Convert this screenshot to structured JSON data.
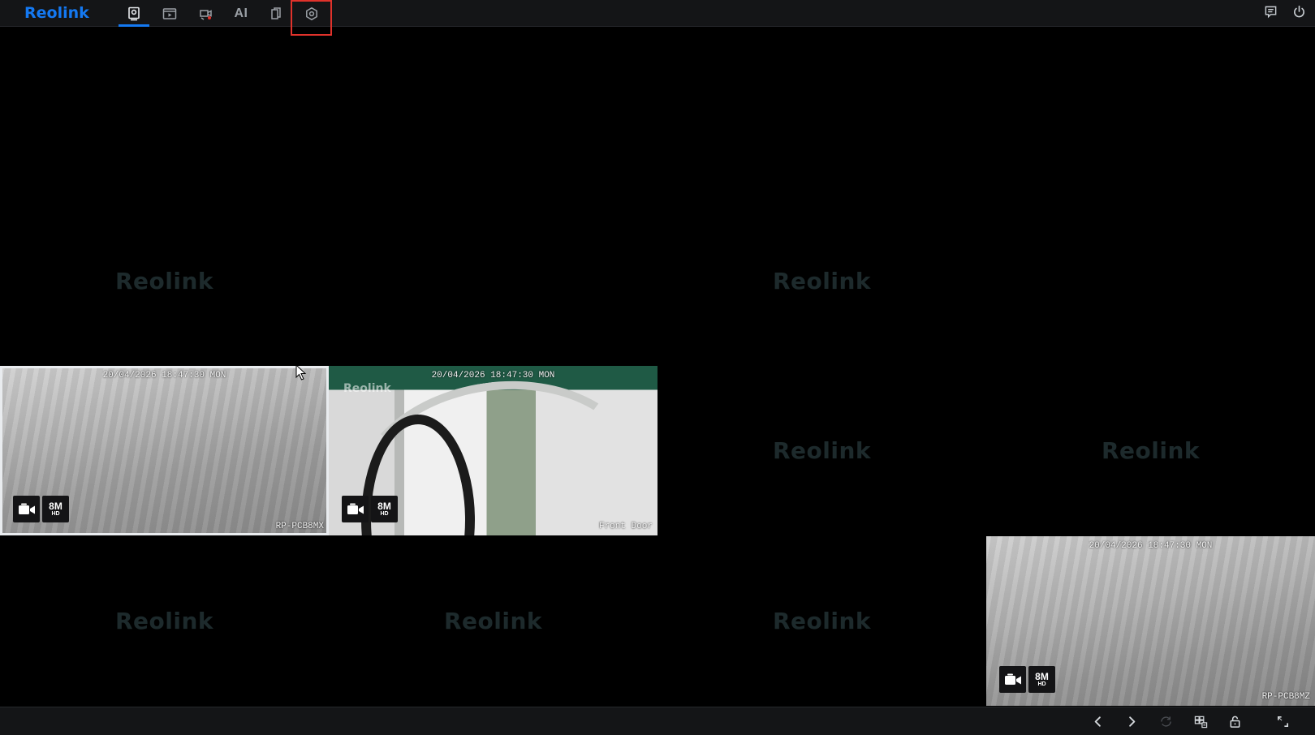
{
  "app": {
    "brand": "Reolink"
  },
  "nav": {
    "items": [
      {
        "id": "live-view",
        "icon": "live-view-icon"
      },
      {
        "id": "playback",
        "icon": "playback-icon"
      },
      {
        "id": "alarm-events",
        "icon": "alarm-events-icon"
      },
      {
        "id": "ai",
        "icon": "ai-icon",
        "label": "AI"
      },
      {
        "id": "files",
        "icon": "files-icon"
      },
      {
        "id": "settings",
        "icon": "settings-icon"
      }
    ],
    "active": "live-view",
    "highlighted": "settings"
  },
  "top_right": [
    {
      "id": "message",
      "icon": "message-icon"
    },
    {
      "id": "power",
      "icon": "power-icon"
    }
  ],
  "grid": {
    "watermark": "Reolink",
    "channels": [
      {
        "row": 1,
        "col": 1,
        "state": "empty"
      },
      {
        "row": 1,
        "col": 2,
        "state": "empty"
      },
      {
        "row": 1,
        "col": 3,
        "state": "empty"
      },
      {
        "row": 1,
        "col": 4,
        "state": "empty"
      },
      {
        "row": 2,
        "col": 1,
        "state": "empty"
      },
      {
        "row": 2,
        "col": 2,
        "state": "empty"
      },
      {
        "row": 2,
        "col": 3,
        "state": "empty"
      },
      {
        "row": 2,
        "col": 4,
        "state": "empty"
      },
      {
        "row": 3,
        "col": 1,
        "state": "live"
      },
      {
        "row": 3,
        "col": 2,
        "state": "live"
      },
      {
        "row": 3,
        "col": 3,
        "state": "empty"
      },
      {
        "row": 3,
        "col": 4,
        "state": "empty"
      },
      {
        "row": 4,
        "col": 1,
        "state": "empty"
      },
      {
        "row": 4,
        "col": 2,
        "state": "empty"
      },
      {
        "row": 4,
        "col": 3,
        "state": "empty"
      },
      {
        "row": 4,
        "col": 4,
        "state": "live"
      }
    ],
    "feeds": {
      "cam1": {
        "timestamp": "20/04/2026 18:47:30 MON",
        "name": "RP-PCB8MX",
        "quality": "8M",
        "hd": "HD",
        "selected": true
      },
      "cam2": {
        "timestamp": "20/04/2026 18:47:30 MON",
        "name": "Front Door",
        "quality": "8M",
        "hd": "HD",
        "osd_watermark": "Reolink",
        "selected": false
      },
      "cam3": {
        "timestamp": "20/04/2026 18:47:30 MON",
        "name": "RP-PCB8MZ",
        "quality": "8M",
        "hd": "HD",
        "selected": false
      }
    }
  },
  "bottom_bar": [
    {
      "id": "prev",
      "icon": "chevron-left-icon"
    },
    {
      "id": "next",
      "icon": "chevron-right-icon"
    },
    {
      "id": "rotate",
      "icon": "rotate-icon",
      "disabled": true
    },
    {
      "id": "layout",
      "icon": "grid-layout-icon"
    },
    {
      "id": "lock",
      "icon": "lock-icon"
    },
    {
      "id": "fullscreen",
      "icon": "fullscreen-icon"
    }
  ],
  "colors": {
    "accent": "#1479f2",
    "highlight": "#e0322b",
    "background": "#000000",
    "bar": "#141517",
    "watermark": "#1d2a2c"
  }
}
